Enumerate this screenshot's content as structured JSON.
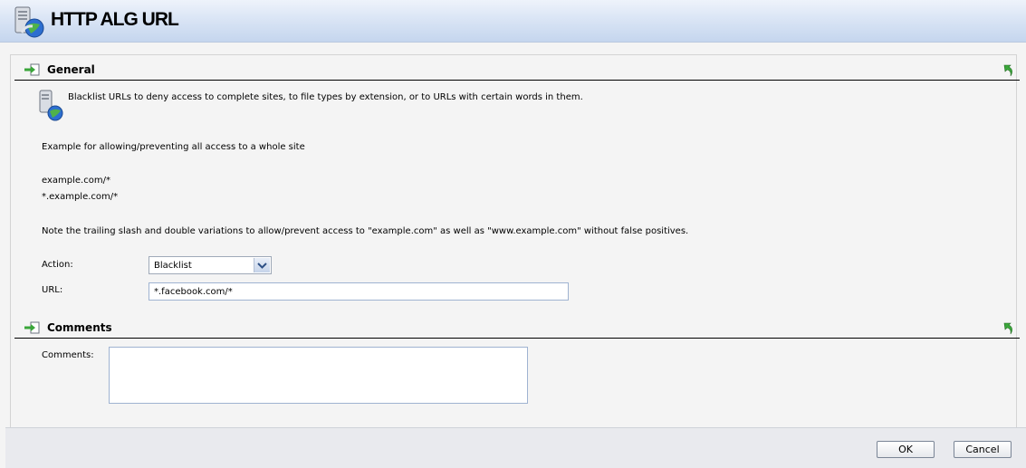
{
  "window": {
    "title": "HTTP ALG URL"
  },
  "general": {
    "heading": "General",
    "description": "Blacklist URLs to deny access to complete sites, to file types by extension, or to URLs with certain words in them.",
    "example_intro": "Example for allowing/preventing all access to a whole site",
    "example_1": "example.com/*",
    "example_2": "*.example.com/*",
    "note": "Note the trailing slash and double variations to allow/prevent access to \"example.com\" as well as \"www.example.com\" without false positives.",
    "action_label": "Action:",
    "action_value": "Blacklist",
    "url_label": "URL:",
    "url_value": "*.facebook.com/*"
  },
  "comments": {
    "heading": "Comments",
    "label": "Comments:",
    "value": ""
  },
  "footer": {
    "ok_label": "OK",
    "cancel_label": "Cancel"
  },
  "icons": {
    "title": "http-alg-url-icon",
    "section": "section-arrow-icon",
    "reset": "green-reset-arrow-icon",
    "dropdown": "chevron-down-icon"
  },
  "colors": {
    "title_gradient_top": "#eef3fb",
    "title_gradient_bottom": "#c5d6ee",
    "reset_green": "#3aa63a"
  }
}
